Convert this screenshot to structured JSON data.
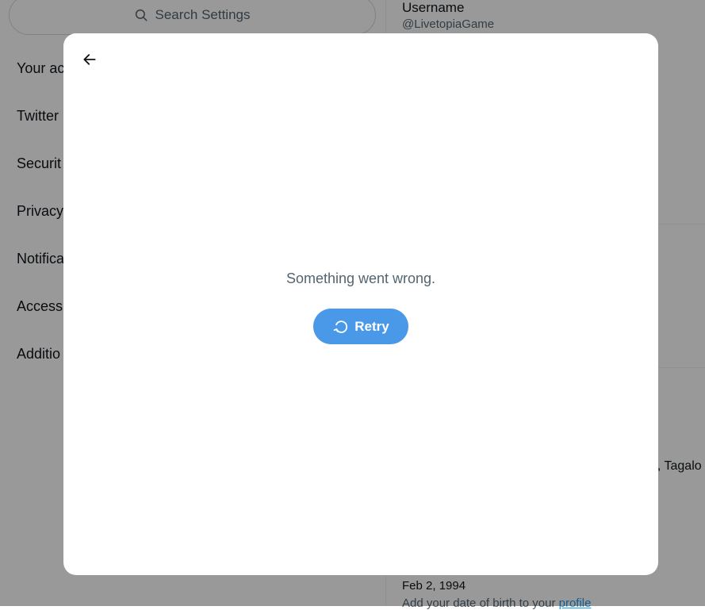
{
  "search": {
    "placeholder": "Search Settings",
    "icon": "search-icon"
  },
  "sidebar": {
    "items": [
      {
        "label": "Your ac"
      },
      {
        "label": "Twitter"
      },
      {
        "label": "Securit"
      },
      {
        "label": "Privacy"
      },
      {
        "label": "Notifica"
      },
      {
        "label": "Access"
      },
      {
        "label": "Additio"
      }
    ]
  },
  "details": {
    "username_label": "Username",
    "username_value": "@LivetopiaGame",
    "languages_partial": "n, Tagalo",
    "birthdate_value": "Feb 2, 1994",
    "birthdate_note": "Add your date of birth to your",
    "birthdate_link": "profile"
  },
  "modal": {
    "back_icon": "arrow-left-icon",
    "error_message": "Something went wrong.",
    "retry_label": "Retry",
    "retry_icon": "refresh-icon"
  },
  "colors": {
    "accent": "#4a99e9",
    "overlay": "rgba(0,0,0,0.40)",
    "muted_text": "#536471"
  }
}
